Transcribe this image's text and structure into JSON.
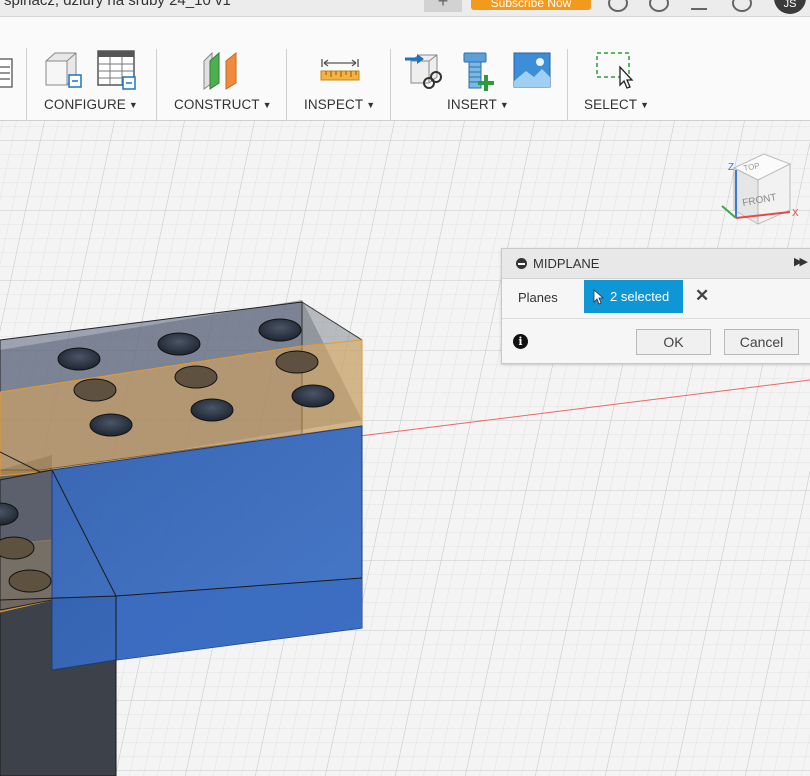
{
  "title_bar": {
    "document_title": "spinacz, dziury na śruby 24_10 v1",
    "close_icon": "close-icon",
    "new_tab_glyph": "+",
    "subscribe_label": "Subscribe Now",
    "user_initials": "JS"
  },
  "toolbar": {
    "groups": [
      {
        "label": "CONFIGURE",
        "icons": [
          "configure-box-icon",
          "configure-table-icon"
        ]
      },
      {
        "label": "CONSTRUCT",
        "icons": [
          "construct-plane-icon"
        ]
      },
      {
        "label": "INSPECT",
        "icons": [
          "measure-ruler-icon"
        ]
      },
      {
        "label": "INSERT",
        "icons": [
          "insert-derive-icon",
          "insert-mcmaster-bolt-icon",
          "insert-canvas-image-icon"
        ]
      },
      {
        "label": "SELECT",
        "icons": [
          "select-window-icon"
        ]
      }
    ],
    "caret": "▼"
  },
  "view_cube": {
    "top_label": "TOP",
    "front_label": "FRONT",
    "z_axis": "Z",
    "x_axis": "X"
  },
  "midplane_dialog": {
    "title": "MIDPLANE",
    "expand_glyph": "▶▶",
    "planes_label": "Planes",
    "selection_label": "2 selected",
    "clear_glyph": "✕",
    "info_glyph": "i",
    "ok_label": "OK",
    "cancel_label": "Cancel"
  },
  "colors": {
    "accent_blue": "#0f96d6",
    "subscribe_orange": "#f39a1e",
    "selected_face_blue": "#3a68b8",
    "plane_orange": "#f5b04a"
  }
}
